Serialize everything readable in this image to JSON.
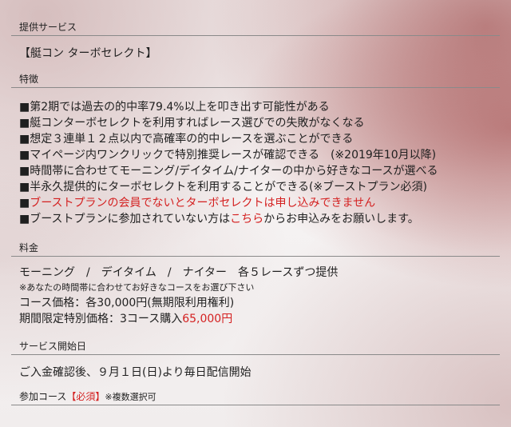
{
  "sections": {
    "service_heading": "提供サービス",
    "service_name": "【艇コン ターボセレクト】",
    "features_heading": "特徴",
    "features": [
      {
        "text": "■第2期では過去の的中率79.4%以上を叩き出す可能性がある"
      },
      {
        "text": "■艇コンターボセレクトを利用すればレース選びでの失敗がなくなる"
      },
      {
        "text": "■想定３連単１２点以内で高確率の的中レースを選ぶことができる"
      },
      {
        "text": "■マイページ内ワンクリックで特別推奨レースが確認できる　(※2019年10月以降)"
      },
      {
        "text": "■時間帯に合わせてモーニング/デイタイム/ナイターの中から好きなコースが選べる"
      },
      {
        "text": "■半永久提供的にターボセレクトを利用することができる(※ブーストプラン必須)"
      },
      {
        "text_prefix": "■",
        "text_red": "ブーストプランの会員でないとターボセレクトは申し込みできません"
      },
      {
        "text_before": "■ブーストプランに参加されていない方は",
        "link": "こちら",
        "text_after": "からお申込みをお願いします。"
      }
    ],
    "price_heading": "料金",
    "courses_line": "モーニング　/　デイタイム　/　ナイター　各５レースずつ提供",
    "courses_note": "※あなたの時間帯に合わせてお好きなコースをお選び下さい",
    "course_price": "コース価格：各30,000円(無期限利用権利)",
    "limited_price_before": "期間限定特別価格：3コース購入",
    "limited_price_red": "65,000円",
    "start_heading": "サービス開始日",
    "start_text": "ご入金確認後、９月１日(日)より毎日配信開始",
    "participation_label": "参加コース",
    "participation_required": "【必須】",
    "participation_note": "※複数選択可"
  },
  "colors": {
    "accent_red": "#d42020",
    "divider": "#8a8a8a"
  }
}
